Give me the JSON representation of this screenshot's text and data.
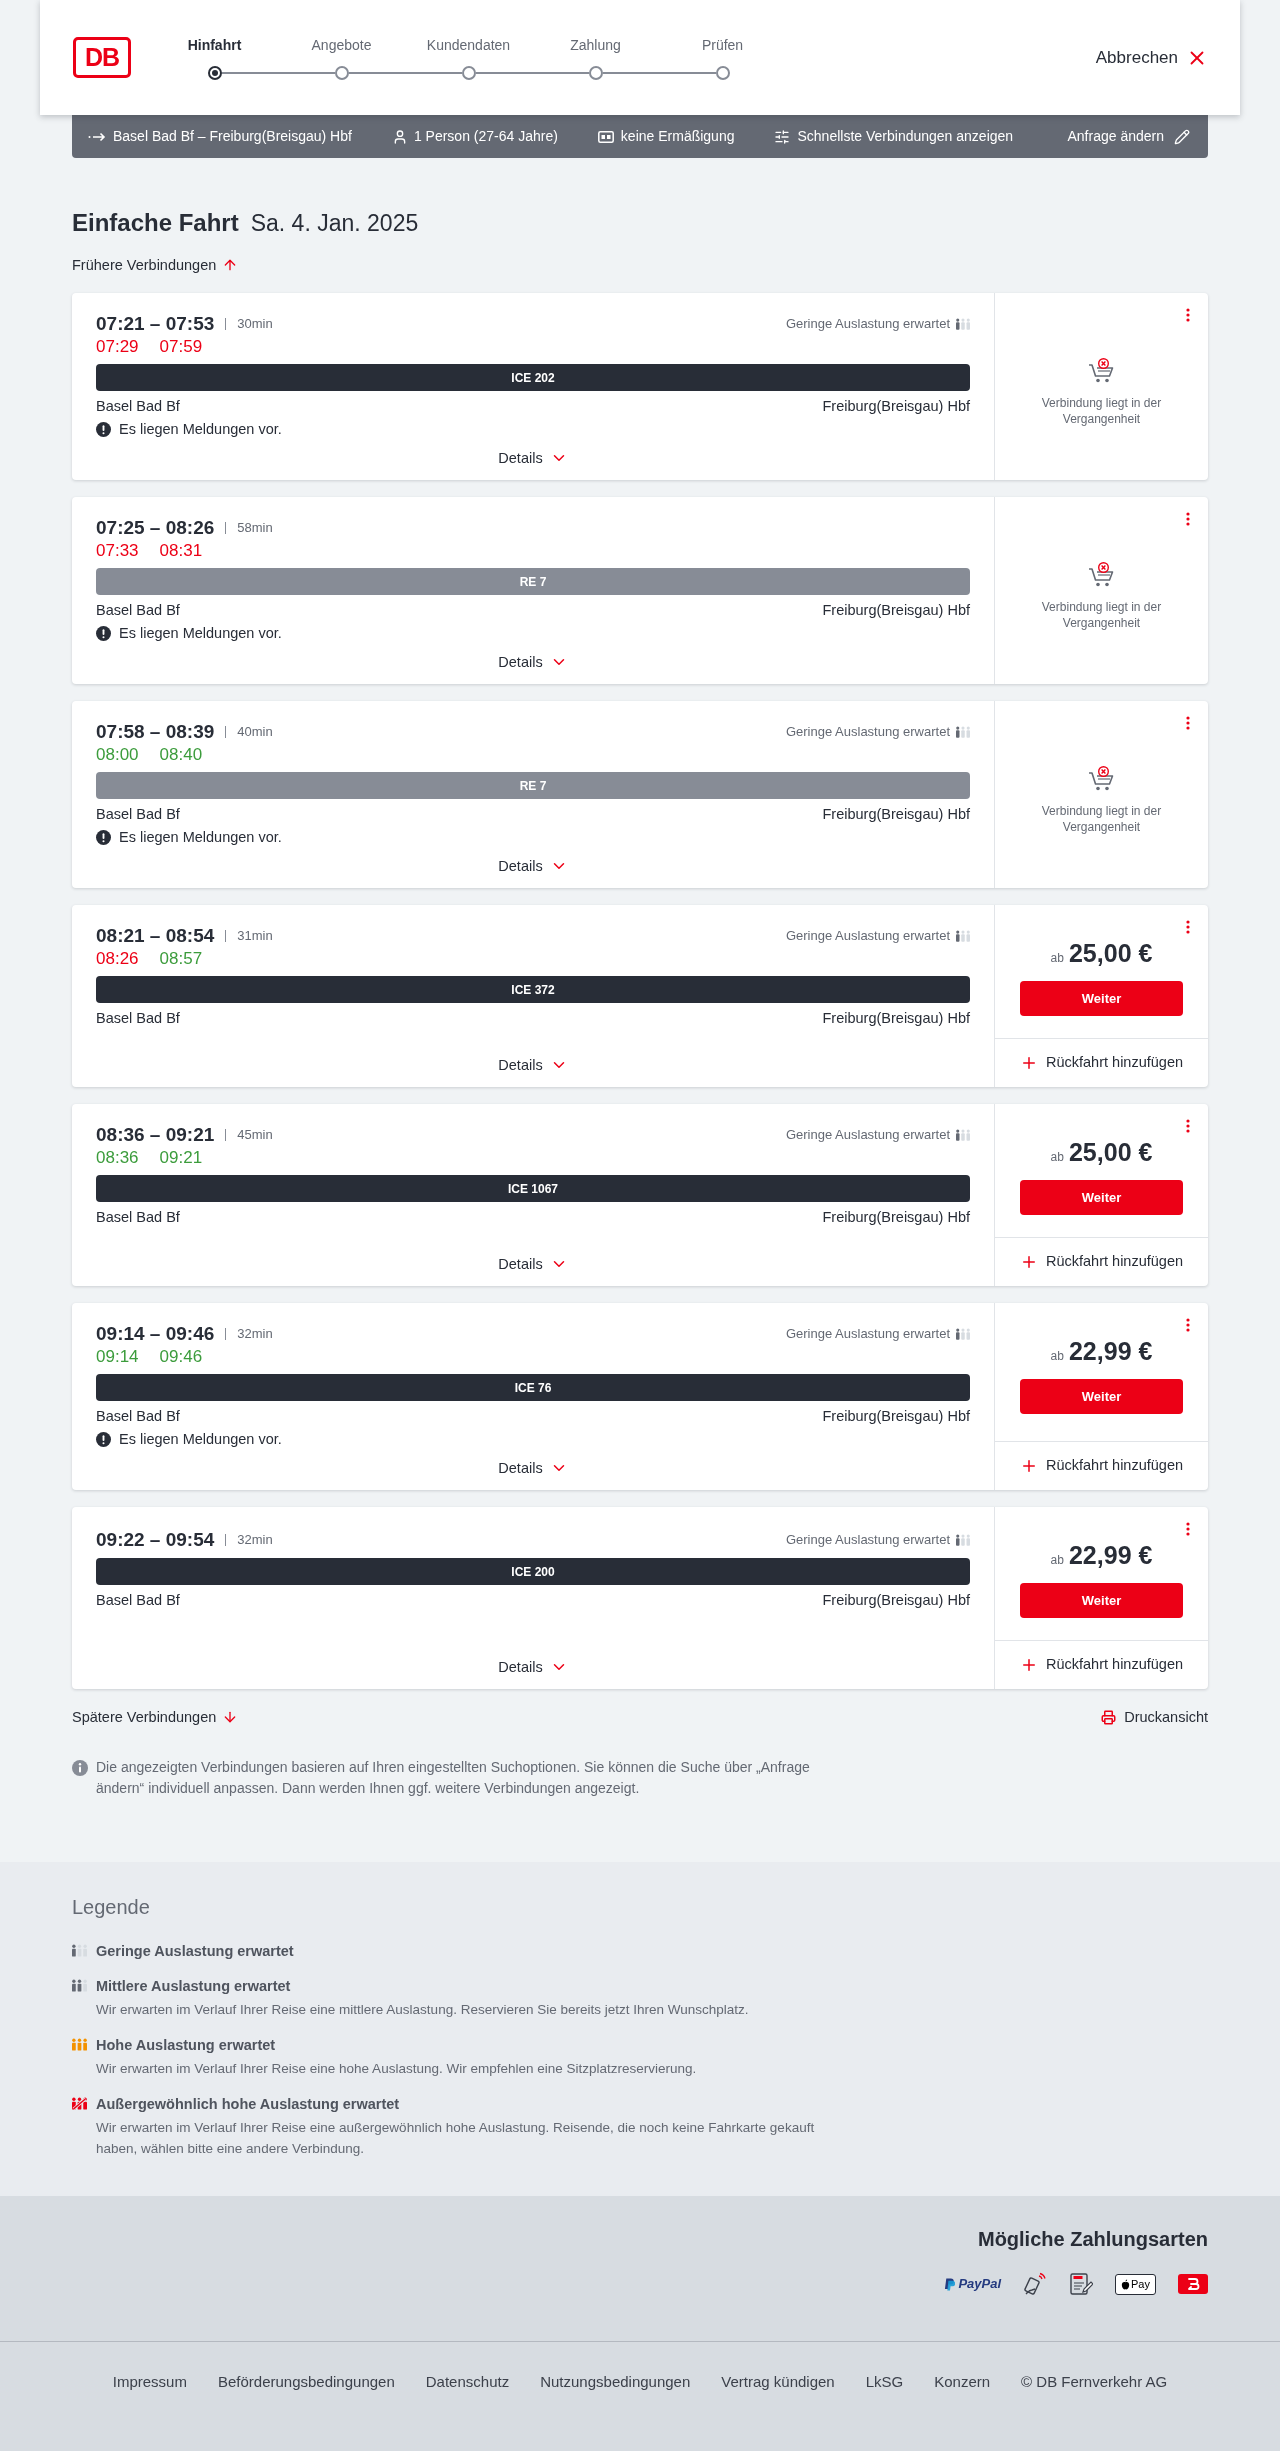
{
  "header": {
    "logo": "DB",
    "steps": [
      {
        "label": "Hinfahrt",
        "selected": true
      },
      {
        "label": "Angebote",
        "selected": false
      },
      {
        "label": "Kundendaten",
        "selected": false
      },
      {
        "label": "Zahlung",
        "selected": false
      },
      {
        "label": "Prüfen",
        "selected": false
      }
    ],
    "cancel": "Abbrechen"
  },
  "search_summary": {
    "route": "Basel Bad Bf – Freiburg(Breisgau) Hbf",
    "travellers": "1 Person (27-64 Jahre)",
    "discount": "keine Ermäßigung",
    "sorting": "Schnellste Verbindungen anzeigen",
    "edit": "Anfrage ändern"
  },
  "heading": {
    "title": "Einfache Fahrt",
    "date": "Sa. 4. Jan. 2025"
  },
  "earlier_link": "Frühere Verbindungen",
  "connections": [
    {
      "times": "07:21 – 07:53",
      "duration": "30min",
      "realtime": [
        {
          "time": "07:29",
          "delayed": true
        },
        {
          "time": "07:59",
          "delayed": true
        }
      ],
      "occupancy": {
        "kind": "low",
        "label": "Geringe Auslastung erwartet"
      },
      "train": {
        "kind": "long_distance",
        "name": "ICE 202"
      },
      "from": "Basel Bad Bf",
      "to": "Freiburg(Breisgau) Hbf",
      "message": "Es liegen Meldungen vor.",
      "details": "Details",
      "offer": {
        "kind": "past",
        "note": "Verbindung liegt in der Vergangenheit"
      }
    },
    {
      "times": "07:25 – 08:26",
      "duration": "58min",
      "realtime": [
        {
          "time": "07:33",
          "delayed": true
        },
        {
          "time": "08:31",
          "delayed": true
        }
      ],
      "train": {
        "kind": "regional",
        "name": "RE 7"
      },
      "from": "Basel Bad Bf",
      "to": "Freiburg(Breisgau) Hbf",
      "message": "Es liegen Meldungen vor.",
      "details": "Details",
      "offer": {
        "kind": "past",
        "note": "Verbindung liegt in der Vergangenheit"
      }
    },
    {
      "times": "07:58 – 08:39",
      "duration": "40min",
      "realtime": [
        {
          "time": "08:00",
          "delayed": false
        },
        {
          "time": "08:40",
          "delayed": false
        }
      ],
      "occupancy": {
        "kind": "low",
        "label": "Geringe Auslastung erwartet"
      },
      "train": {
        "kind": "regional",
        "name": "RE 7"
      },
      "from": "Basel Bad Bf",
      "to": "Freiburg(Breisgau) Hbf",
      "message": "Es liegen Meldungen vor.",
      "details": "Details",
      "offer": {
        "kind": "past",
        "note": "Verbindung liegt in der Vergangenheit"
      }
    },
    {
      "times": "08:21 – 08:54",
      "duration": "31min",
      "realtime": [
        {
          "time": "08:26",
          "delayed": true
        },
        {
          "time": "08:57",
          "delayed": false
        }
      ],
      "occupancy": {
        "kind": "low",
        "label": "Geringe Auslastung erwartet"
      },
      "train": {
        "kind": "long_distance",
        "name": "ICE 372"
      },
      "from": "Basel Bad Bf",
      "to": "Freiburg(Breisgau) Hbf",
      "details": "Details",
      "offer": {
        "kind": "bookable",
        "prefix": "ab",
        "price": "25,00 €",
        "button": "Weiter",
        "return_trip": "Rückfahrt hinzufügen"
      }
    },
    {
      "times": "08:36 – 09:21",
      "duration": "45min",
      "realtime": [
        {
          "time": "08:36",
          "delayed": false
        },
        {
          "time": "09:21",
          "delayed": false
        }
      ],
      "occupancy": {
        "kind": "low",
        "label": "Geringe Auslastung erwartet"
      },
      "train": {
        "kind": "long_distance",
        "name": "ICE 1067"
      },
      "from": "Basel Bad Bf",
      "to": "Freiburg(Breisgau) Hbf",
      "details": "Details",
      "offer": {
        "kind": "bookable",
        "prefix": "ab",
        "price": "25,00 €",
        "button": "Weiter",
        "return_trip": "Rückfahrt hinzufügen"
      }
    },
    {
      "times": "09:14 – 09:46",
      "duration": "32min",
      "realtime": [
        {
          "time": "09:14",
          "delayed": false
        },
        {
          "time": "09:46",
          "delayed": false
        }
      ],
      "occupancy": {
        "kind": "low",
        "label": "Geringe Auslastung erwartet"
      },
      "train": {
        "kind": "long_distance",
        "name": "ICE 76"
      },
      "from": "Basel Bad Bf",
      "to": "Freiburg(Breisgau) Hbf",
      "message": "Es liegen Meldungen vor.",
      "details": "Details",
      "offer": {
        "kind": "bookable",
        "prefix": "ab",
        "price": "22,99 €",
        "button": "Weiter",
        "return_trip": "Rückfahrt hinzufügen"
      }
    },
    {
      "times": "09:22 – 09:54",
      "duration": "32min",
      "occupancy": {
        "kind": "low",
        "label": "Geringe Auslastung erwartet"
      },
      "train": {
        "kind": "long_distance",
        "name": "ICE 200"
      },
      "from": "Basel Bad Bf",
      "to": "Freiburg(Breisgau) Hbf",
      "details": "Details",
      "offer": {
        "kind": "bookable",
        "prefix": "ab",
        "price": "22,99 €",
        "button": "Weiter",
        "return_trip": "Rückfahrt hinzufügen"
      }
    }
  ],
  "later_link": "Spätere Verbindungen",
  "print_link": "Druckansicht",
  "note": "Die angezeigten Verbindungen basieren auf Ihren eingestellten Suchoptionen. Sie können die Suche über „Anfrage ändern“ individuell anpassen. Dann werden Ihnen ggf. weitere Verbindungen angezeigt.",
  "legend": {
    "title": "Legende",
    "items": [
      {
        "kind": "low",
        "title": "Geringe Auslastung erwartet"
      },
      {
        "kind": "medium",
        "title": "Mittlere Auslastung erwartet",
        "description": "Wir erwarten im Verlauf Ihrer Reise eine mittlere Auslastung. Reservieren Sie bereits jetzt Ihren Wunschplatz."
      },
      {
        "kind": "high",
        "title": "Hohe Auslastung erwartet",
        "description": "Wir erwarten im Verlauf Ihrer Reise eine hohe Auslastung. Wir empfehlen eine Sitzplatzreservierung."
      },
      {
        "kind": "exceptional",
        "title": "Außergewöhnlich hohe Auslastung erwartet",
        "description": "Wir erwarten im Verlauf Ihrer Reise eine außergewöhnlich hohe Auslastung. Reisende, die noch keine Fahrkarte gekauft haben, wählen bitte eine andere Verbindung."
      }
    ]
  },
  "payment": {
    "title": "Mögliche Zahlungsarten",
    "methods": [
      {
        "kind": "paypal",
        "label": "PayPal"
      },
      {
        "kind": "contactless"
      },
      {
        "kind": "direct_debit"
      },
      {
        "kind": "apple_pay",
        "label": "Pay"
      },
      {
        "kind": "voucher"
      }
    ]
  },
  "footer": {
    "links": [
      "Impressum",
      "Beförderungsbedingungen",
      "Datenschutz",
      "Nutzungsbedingungen",
      "Vertrag kündigen",
      "LkSG",
      "Konzern"
    ],
    "copyright": "© DB Fernverkehr AG"
  }
}
